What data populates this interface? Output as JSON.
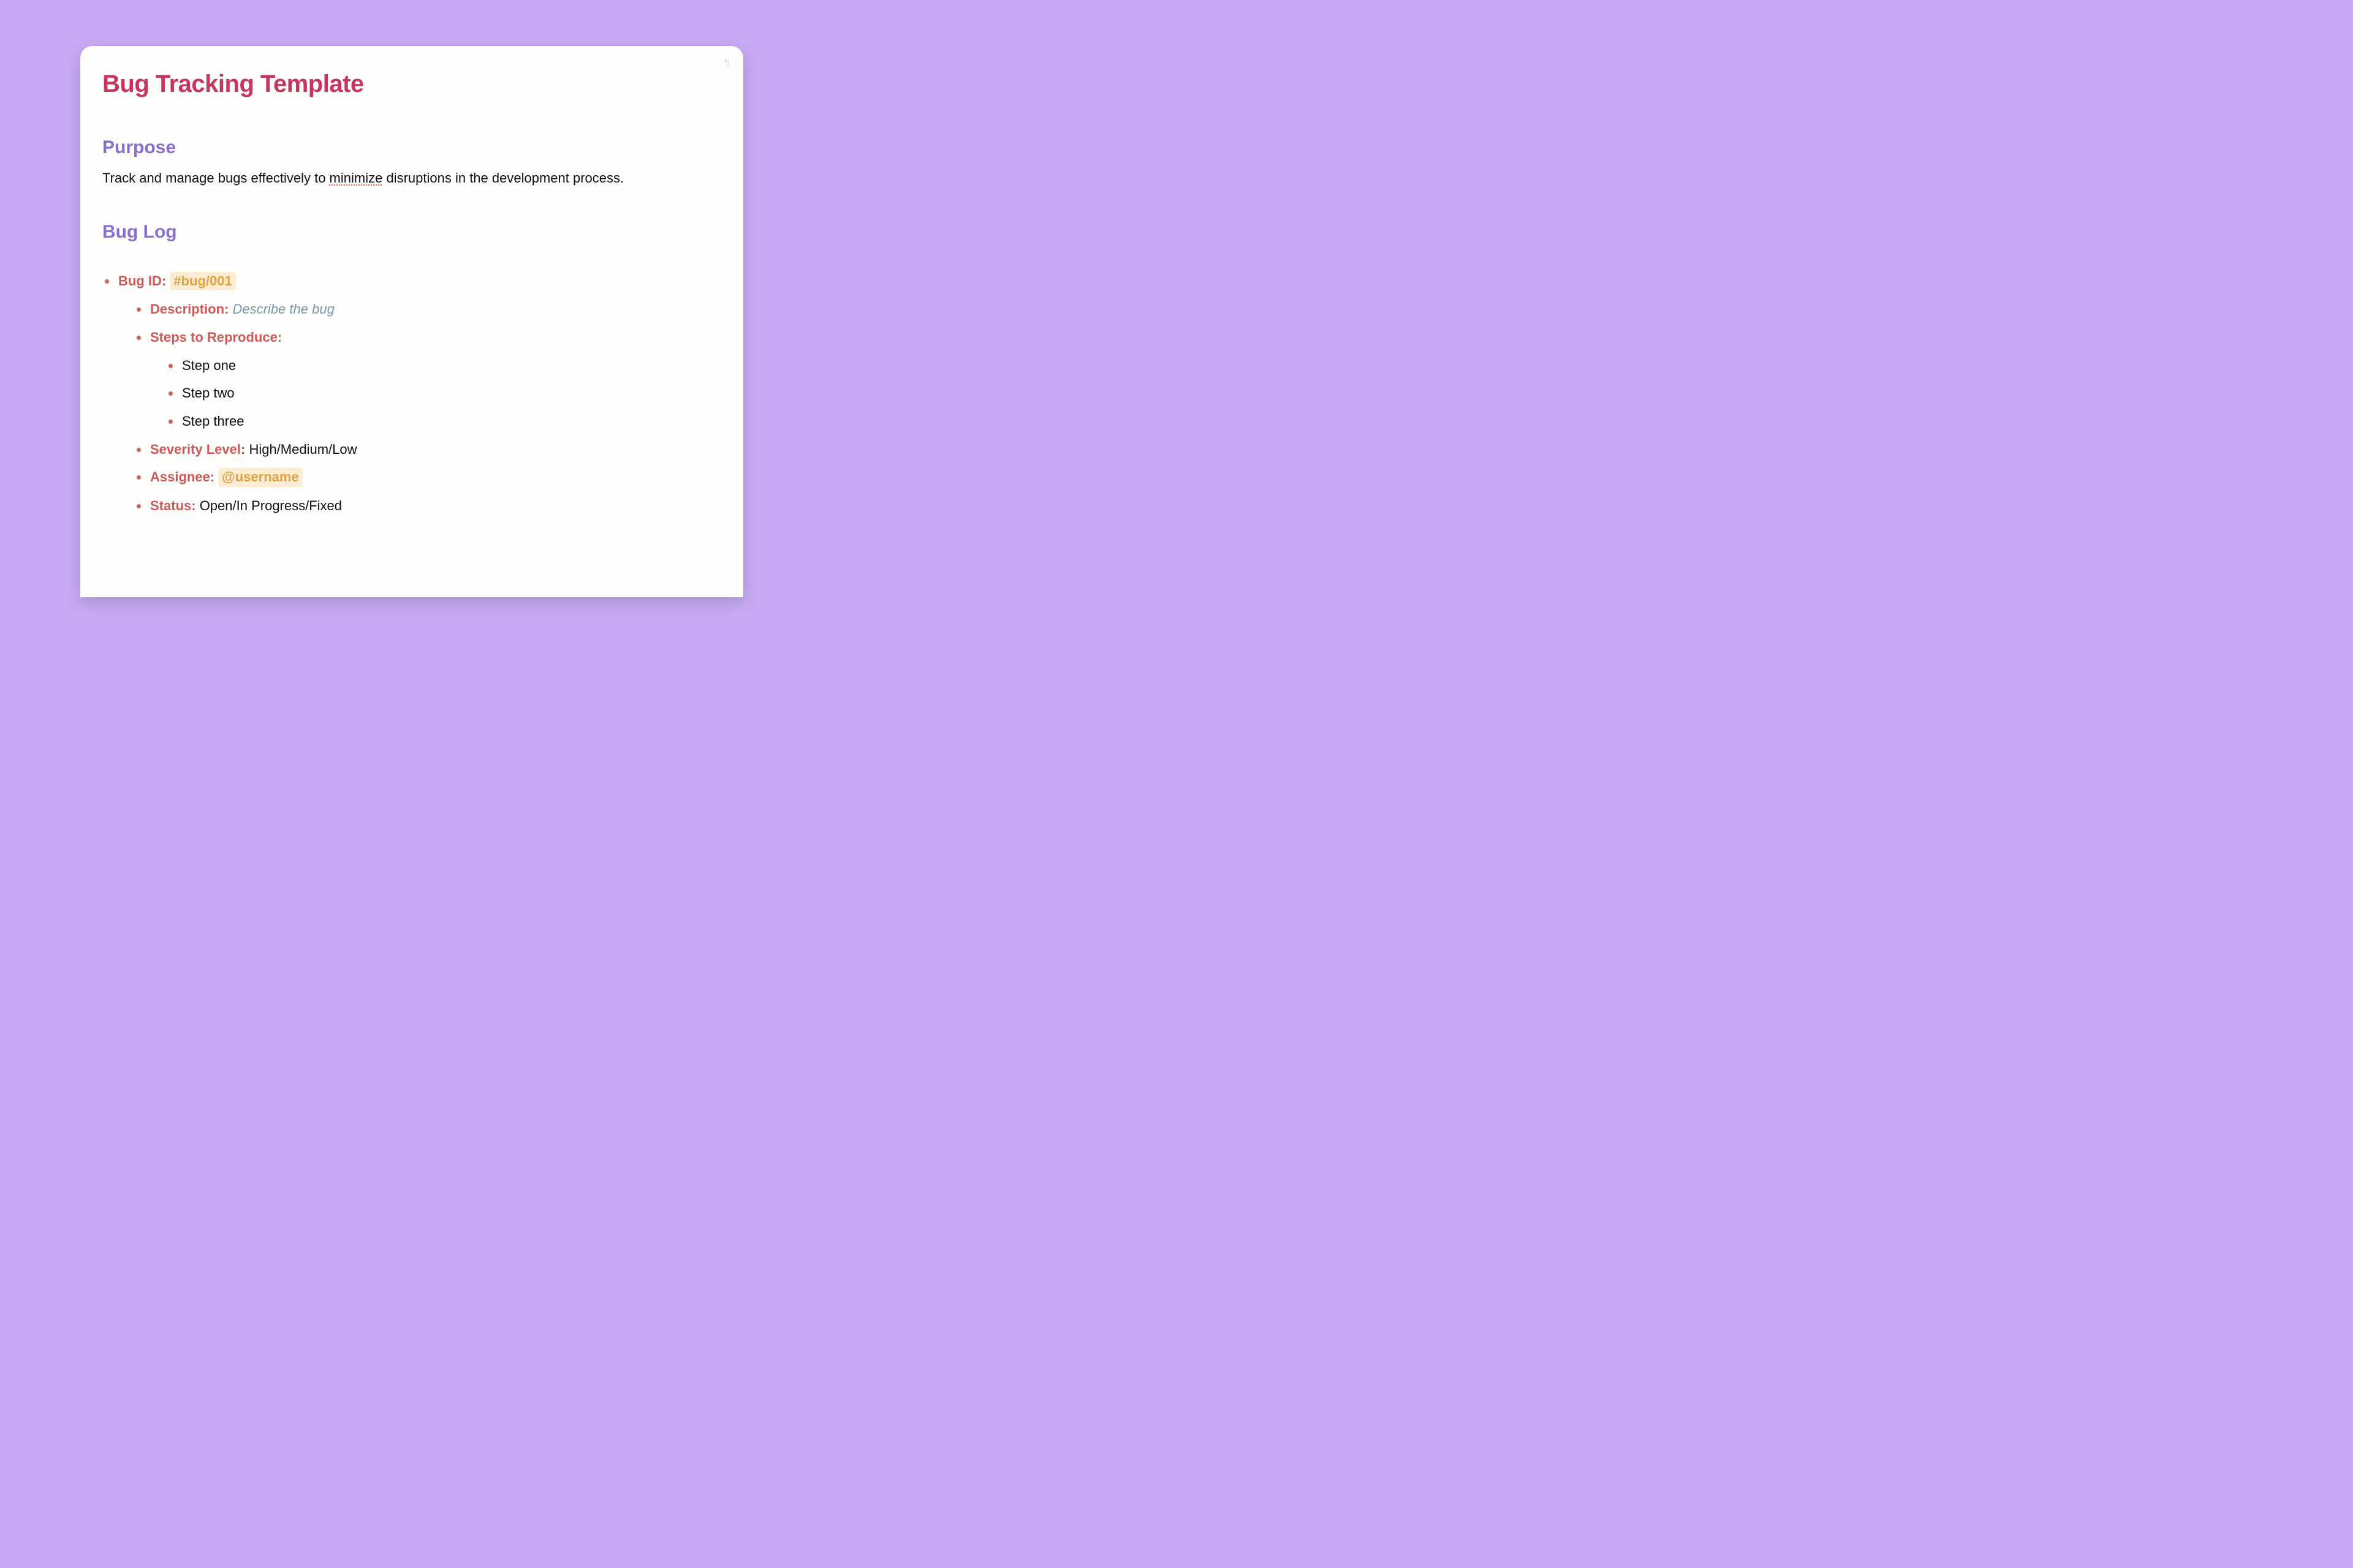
{
  "title": "Bug Tracking Template",
  "purpose": {
    "heading": "Purpose",
    "text_before": "Track and manage bugs effectively to ",
    "underlined_word": "minimize",
    "text_after": " disruptions in the development process."
  },
  "buglog": {
    "heading": "Bug Log",
    "bug_id_label": "Bug ID:",
    "bug_id_value": "#bug/001",
    "description_label": "Description:",
    "description_value": "Describe the bug",
    "steps_label": "Steps to Reproduce:",
    "steps": [
      "Step one",
      "Step two",
      "Step three"
    ],
    "severity_label": "Severity Level:",
    "severity_value": "High/Medium/Low",
    "assignee_label": "Assignee:",
    "assignee_value": "@username",
    "status_label": "Status:",
    "status_value": "Open/In Progress/Fixed"
  }
}
